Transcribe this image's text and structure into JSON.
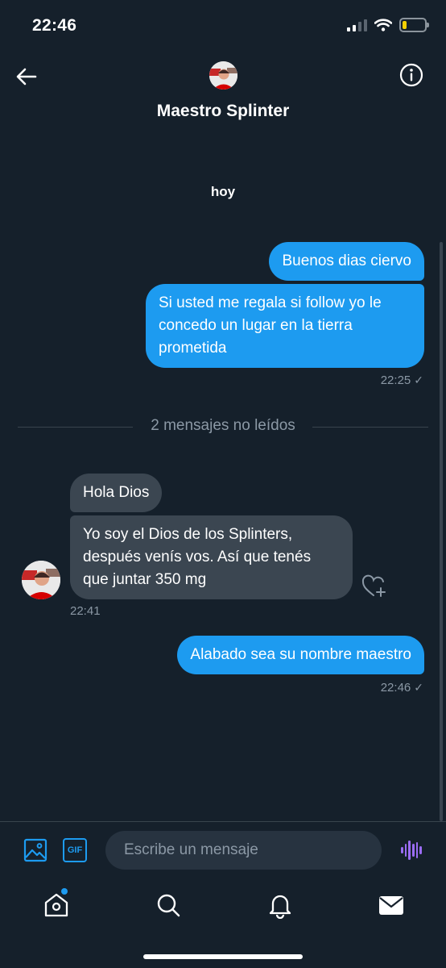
{
  "status_bar": {
    "time": "22:46",
    "battery_level": 0.18
  },
  "header": {
    "name": "Maestro Splinter",
    "avatar": "avatar-icon",
    "back": "back-arrow-icon",
    "info": "info-icon"
  },
  "conversation": {
    "day_label": "hoy",
    "messages": [
      {
        "direction": "out",
        "text": "Buenos dias ciervo"
      },
      {
        "direction": "out",
        "text": "Si usted me regala si follow yo le concedo un lugar en la tierra prometida"
      },
      {
        "direction": "in",
        "text": "Hola Dios"
      },
      {
        "direction": "in",
        "text": "Yo soy el Dios de los Splinters, después venís vos. Así que tenés que juntar 350 mg"
      },
      {
        "direction": "out",
        "text": "Alabado sea su nombre maestro"
      }
    ],
    "timestamps": {
      "first_out": "22:25",
      "incoming": "22:41",
      "last_out": "22:46"
    },
    "read_check": "✓",
    "unread_divider": "2 mensajes no leídos"
  },
  "composer": {
    "placeholder": "Escribe un mensaje",
    "gif_label": "GIF"
  },
  "tabbar": {
    "items": [
      "home-icon",
      "search-icon",
      "notifications-icon",
      "messages-icon"
    ]
  },
  "colors": {
    "background": "#15202b",
    "accent": "#1d9bf0",
    "incoming_bubble": "#3b4651",
    "voice": "#9b6cf5"
  }
}
